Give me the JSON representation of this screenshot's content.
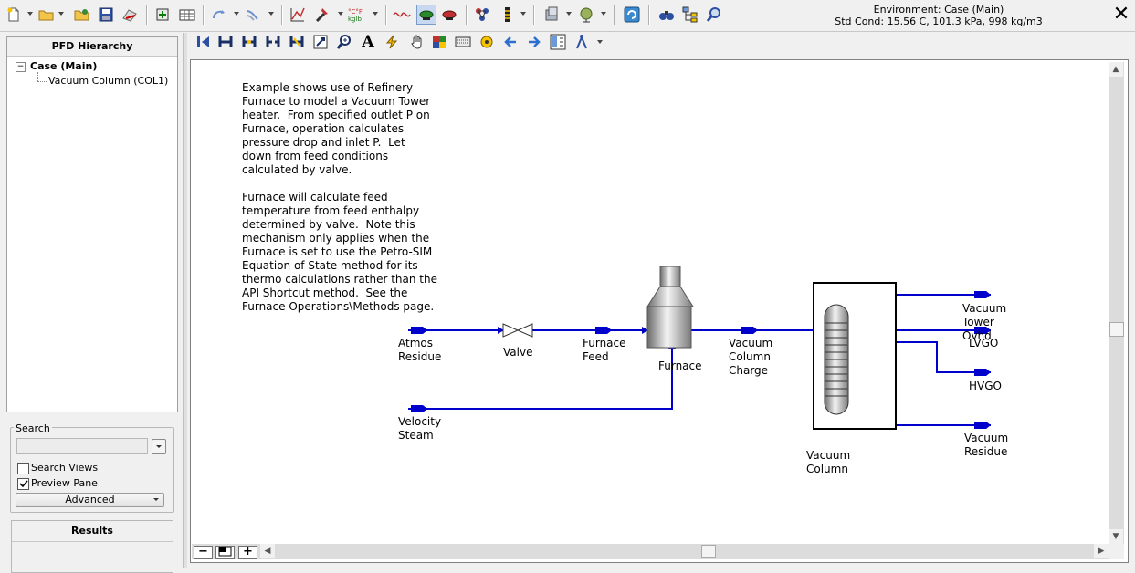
{
  "toolbar": {
    "environment": "Environment: Case (Main)",
    "std_cond": "Std Cond: 15.56 C, 101.3 kPa, 998 kg/m3",
    "close_label": "✕"
  },
  "left_panel": {
    "hierarchy_title": "PFD Hierarchy",
    "tree_toggle": "−",
    "tree_root": "Case (Main)",
    "tree_child": "Vacuum Column (COL1)",
    "search_label": "Search",
    "search_value": "",
    "search_views_label": "Search Views",
    "search_views_checked": false,
    "preview_pane_label": "Preview Pane",
    "preview_pane_checked": true,
    "advanced_label": "Advanced",
    "results_title": "Results"
  },
  "canvas": {
    "note_paragraph_1": "Example shows use of Refinery\nFurnace to model a Vacuum Tower\nheater.  From specified outlet P on\nFurnace, operation calculates\npressure drop and inlet P.  Let\ndown from feed conditions\ncalculated by valve.",
    "note_paragraph_2": "Furnace will calculate feed\ntemperature from feed enthalpy\ndetermined by valve.  Note this\nmechanism only applies when the\nFurnace is set to use the Petro-SIM\nEquation of State method for its\nthermo calculations rather than the\nAPI Shortcut method.  See the\nFurnace Operations\\Methods page.",
    "streams": {
      "atmos_residue": [
        "Atmos",
        "Residue"
      ],
      "valve": "Valve",
      "furnace_feed": [
        "Furnace",
        "Feed"
      ],
      "furnace": "Furnace",
      "vacuum_column_charge": [
        "Vacuum",
        "Column",
        "Charge"
      ],
      "velocity_steam": [
        "Velocity",
        "Steam"
      ],
      "vacuum_column": [
        "Vacuum",
        "Column"
      ],
      "vacuum_tower_ovhd": [
        "Vacuum",
        "Tower",
        "Ovhd"
      ],
      "lvgo": "LVGO",
      "hvgo": "HVGO",
      "vacuum_residue": [
        "Vacuum",
        "Residue"
      ]
    },
    "stream_color": "#0000cc"
  },
  "zoom": {
    "minus": "−",
    "plus": "+"
  }
}
